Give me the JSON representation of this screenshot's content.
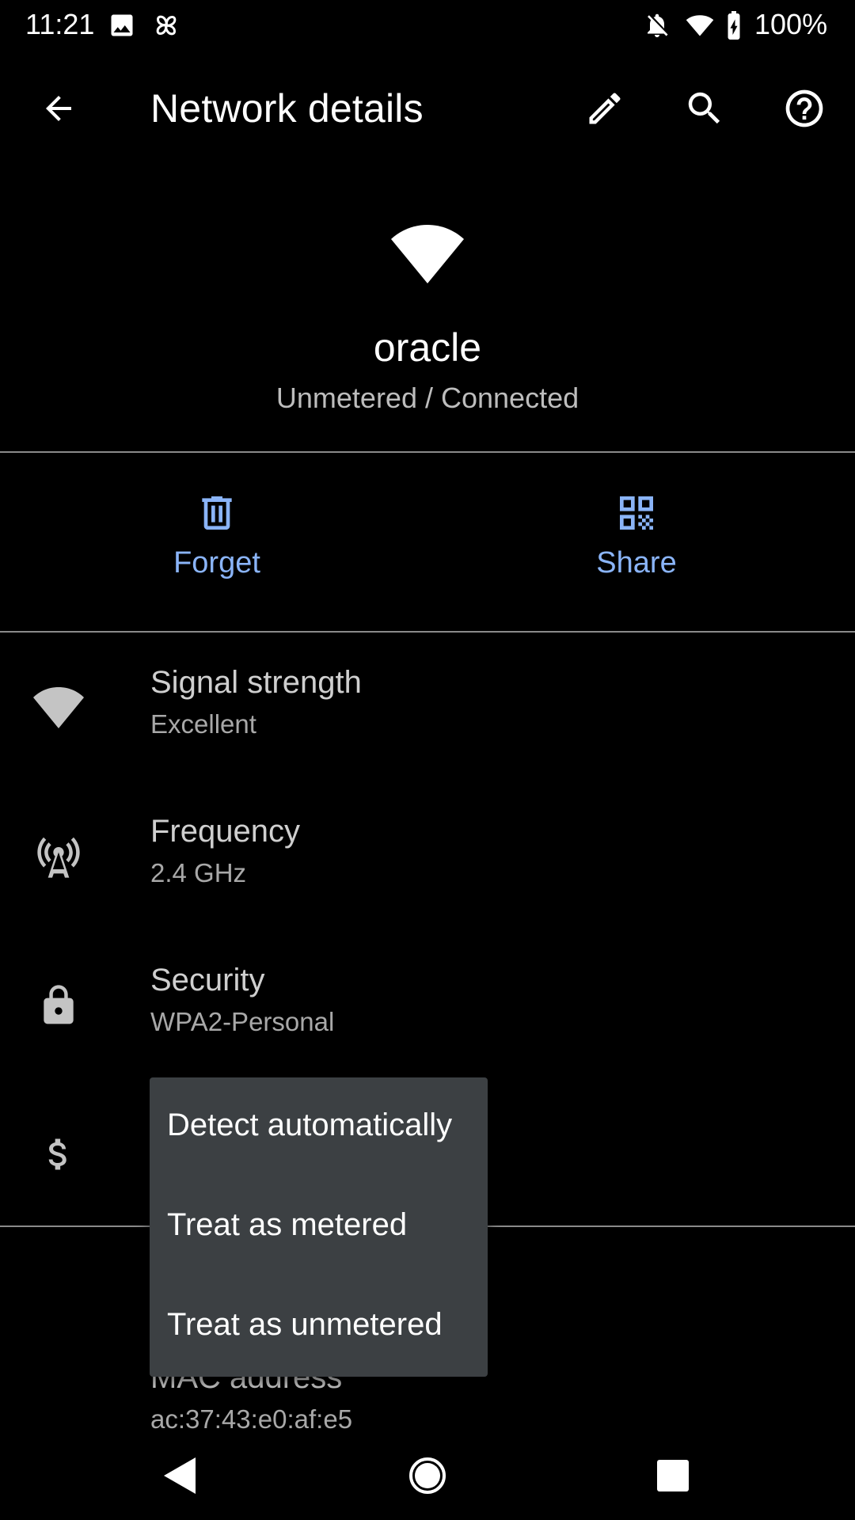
{
  "status_bar": {
    "time": "11:21",
    "battery_percent": "100%",
    "icons": [
      "image-icon",
      "pinwheel-icon",
      "notifications-off-icon",
      "wifi-icon",
      "battery-charging-icon"
    ]
  },
  "app_bar": {
    "title": "Network details",
    "actions": [
      "back-arrow-icon",
      "edit-pencil-icon",
      "search-icon",
      "help-icon"
    ]
  },
  "network": {
    "name": "oracle",
    "status": "Unmetered / Connected"
  },
  "actions": {
    "forget_label": "Forget",
    "share_label": "Share"
  },
  "details": [
    {
      "icon": "wifi-signal-icon",
      "title": "Signal strength",
      "value": "Excellent"
    },
    {
      "icon": "antenna-icon",
      "title": "Frequency",
      "value": "2.4 GHz"
    },
    {
      "icon": "lock-icon",
      "title": "Security",
      "value": "WPA2-Personal"
    },
    {
      "icon": "dollar-icon",
      "title": "",
      "value": ""
    },
    {
      "icon": "",
      "title": "MAC address",
      "value": "ac:37:43:e0:af:e5"
    }
  ],
  "popup_menu": {
    "items": [
      "Detect automatically",
      "Treat as metered",
      "Treat as unmetered"
    ]
  },
  "colors": {
    "background": "#000000",
    "accent": "#8ab4f8",
    "menu_background": "#3c4043",
    "divider": "#8a8a8a"
  },
  "nav_bar": {
    "buttons": [
      "nav-back-icon",
      "nav-home-icon",
      "nav-recents-icon"
    ]
  }
}
